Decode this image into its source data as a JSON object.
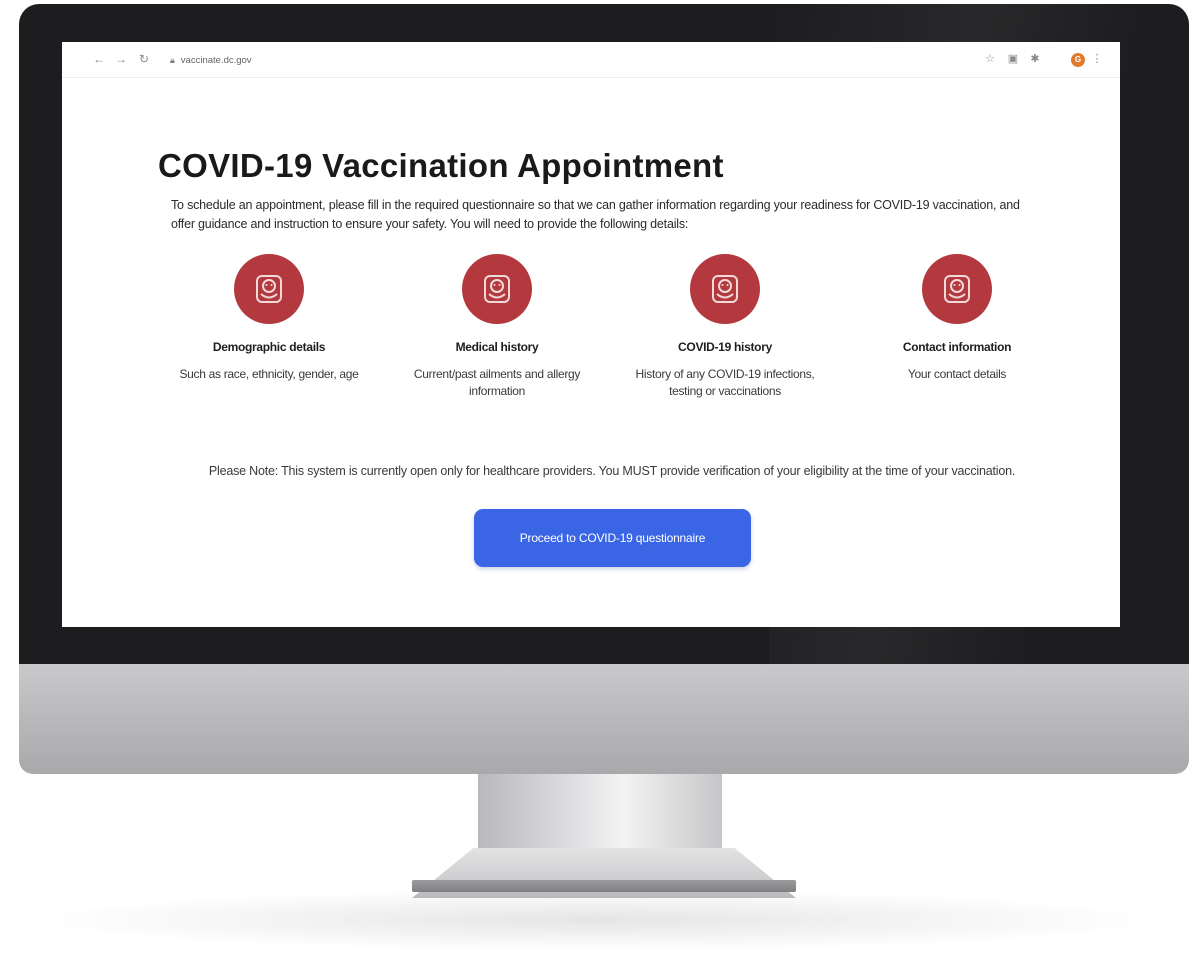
{
  "browser": {
    "url": "vaccinate.dc.gov",
    "profile_initial": "G"
  },
  "page": {
    "title": "COVID-19 Vaccination Appointment",
    "intro": "To schedule an appointment, please fill in the required questionnaire so that we can gather information regarding your readiness for COVID-19 vaccination, and offer guidance and instruction to ensure your safety. You will need to provide the following details:",
    "features": [
      {
        "title": "Demographic details",
        "description": "Such as race, ethnicity, gender, age",
        "icon": "face-mask-icon"
      },
      {
        "title": "Medical history",
        "description": "Current/past ailments and allergy information",
        "icon": "face-mask-icon"
      },
      {
        "title": "COVID-19 history",
        "description": "History of any COVID-19 infections, testing or vaccinations",
        "icon": "face-mask-icon"
      },
      {
        "title": "Contact information",
        "description": "Your contact details",
        "icon": "face-mask-icon"
      }
    ],
    "note": "Please Note: This system is currently open only for healthcare providers. You MUST provide verification of your eligibility at the time of your vaccination.",
    "proceed_label": "Proceed to COVID-19 questionnaire"
  },
  "colors": {
    "icon_circle": "#b3393e",
    "button": "#3a66e6",
    "bezel": "#1d1d1f"
  }
}
